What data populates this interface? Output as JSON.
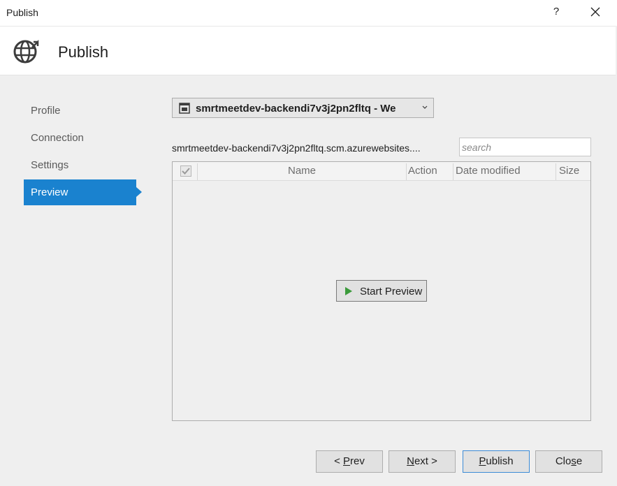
{
  "window": {
    "title": "Publish",
    "help_label": "?"
  },
  "header": {
    "title": "Publish"
  },
  "nav": {
    "items": [
      {
        "label": "Profile"
      },
      {
        "label": "Connection"
      },
      {
        "label": "Settings"
      },
      {
        "label": "Preview"
      }
    ],
    "active": "Preview"
  },
  "profile": {
    "selected": "smrtmeetdev-backendi7v3j2pn2fltq - We"
  },
  "preview": {
    "url": "smrtmeetdev-backendi7v3j2pn2fltq.scm.azurewebsites....",
    "search_placeholder": "search",
    "columns": {
      "name": "Name",
      "action": "Action",
      "date_modified": "Date modified",
      "size": "Size"
    },
    "start_button": "Start Preview"
  },
  "footer": {
    "prev_prefix": "< ",
    "prev_key": "P",
    "prev_rest": "rev",
    "next_prefix": "",
    "next_key": "N",
    "next_rest": "ext >",
    "publish_prefix": "",
    "publish_key": "P",
    "publish_rest": "ublish",
    "close_prefix": "Clo",
    "close_key": "s",
    "close_rest": "e"
  },
  "colors": {
    "accent": "#1a82cf",
    "play": "#3a9a3a"
  },
  "icons": [
    "globe-publish-icon",
    "close-icon",
    "web-app-icon",
    "chevron-down-icon",
    "checkbox-checked-icon",
    "play-icon"
  ]
}
